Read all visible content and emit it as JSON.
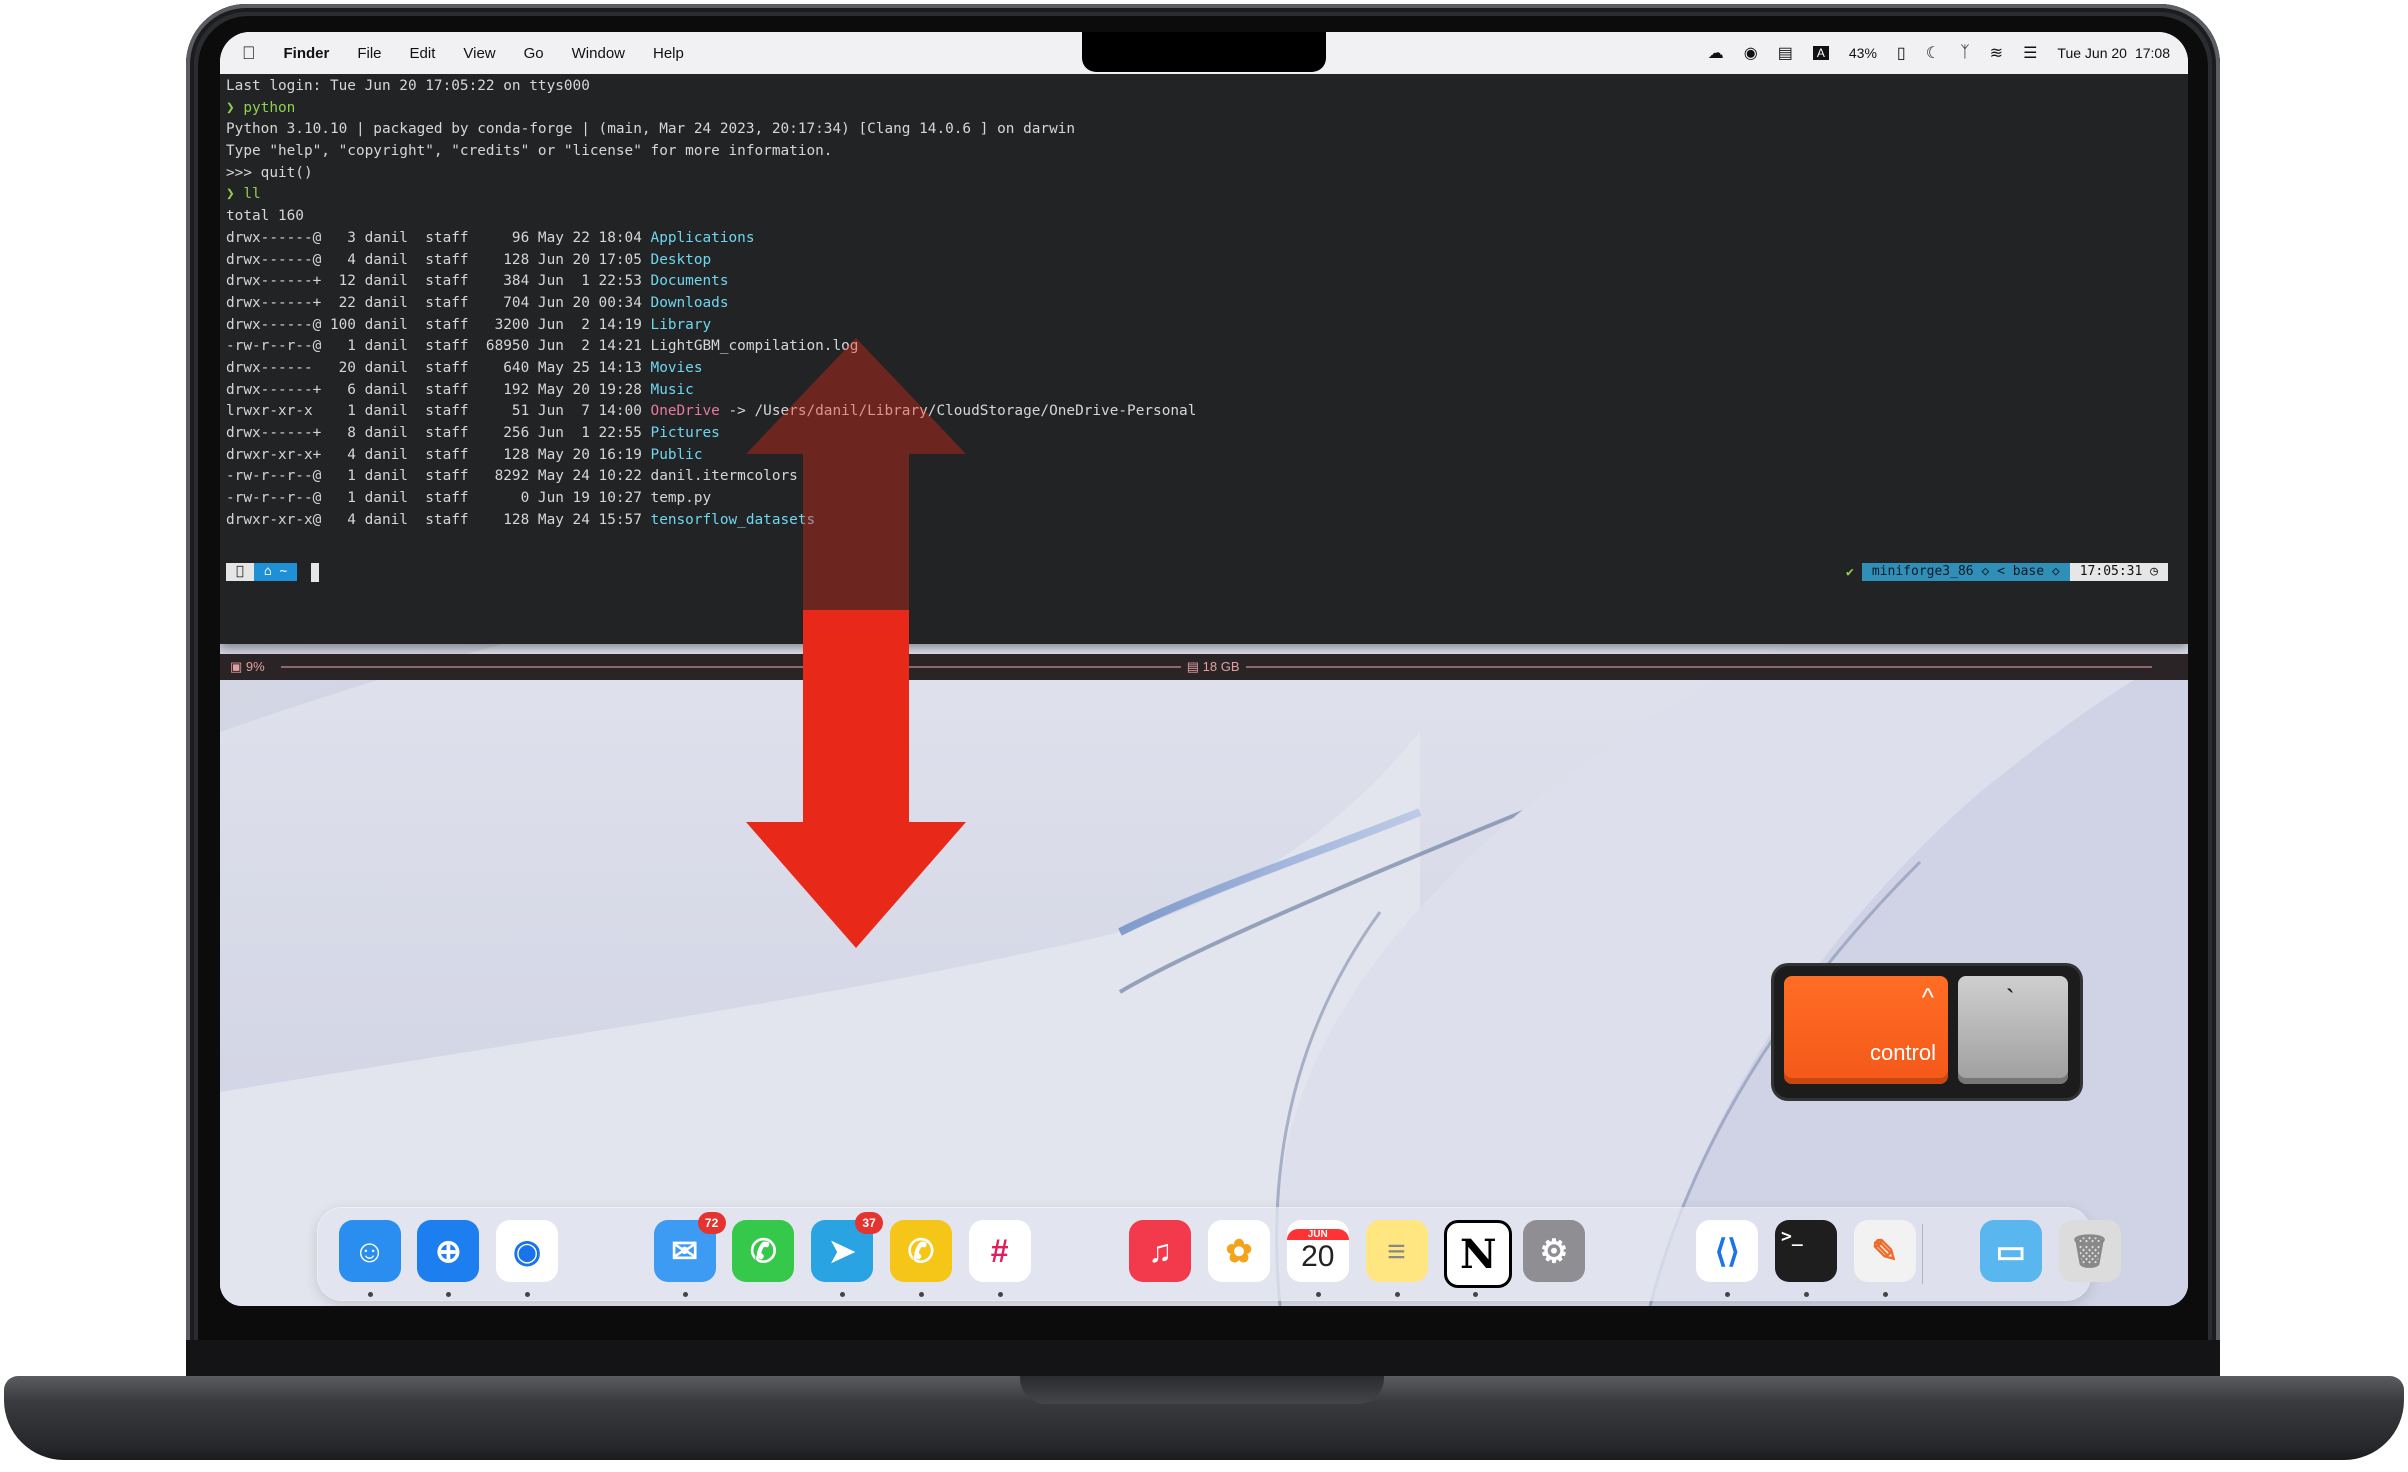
{
  "menubar": {
    "apple_icon": "apple-icon",
    "app_name": "Finder",
    "items": [
      "File",
      "Edit",
      "View",
      "Go",
      "Window",
      "Help"
    ],
    "battery": "43%",
    "date": "Tue Jun 20",
    "time": "17:08",
    "icons": [
      "cloud-icon",
      "onepassword-icon",
      "chat-icon",
      "keyboard-input-icon",
      "battery-icon",
      "moon-icon",
      "bluetooth-icon",
      "wifi-icon",
      "control-center-icon"
    ]
  },
  "terminal": {
    "lines": [
      {
        "text": "Last login: Tue Jun 20 17:05:22 on ttys000"
      },
      {
        "prompt": "❯",
        "text": " python"
      },
      {
        "text": "Python 3.10.10 | packaged by conda-forge | (main, Mar 24 2023, 20:17:34) [Clang 14.0.6 ] on darwin"
      },
      {
        "text": "Type \"help\", \"copyright\", \"credits\" or \"license\" for more information."
      },
      {
        "text": ">>> quit()"
      },
      {
        "prompt": "❯",
        "text": " ll"
      },
      {
        "text": "total 160"
      }
    ],
    "listing": [
      {
        "meta": "drwx------@   3 danil  staff     96 May 22 18:04 ",
        "name": "Applications",
        "color": "cyan"
      },
      {
        "meta": "drwx------@   4 danil  staff    128 Jun 20 17:05 ",
        "name": "Desktop",
        "color": "cyan"
      },
      {
        "meta": "drwx------+  12 danil  staff    384 Jun  1 22:53 ",
        "name": "Documents",
        "color": "cyan"
      },
      {
        "meta": "drwx------+  22 danil  staff    704 Jun 20 00:34 ",
        "name": "Downloads",
        "color": "cyan"
      },
      {
        "meta": "drwx------@ 100 danil  staff   3200 Jun  2 14:19 ",
        "name": "Library",
        "color": "cyan"
      },
      {
        "meta": "-rw-r--r--@   1 danil  staff  68950 Jun  2 14:21 ",
        "name": "LightGBM_compilation.log",
        "color": "plain"
      },
      {
        "meta": "drwx------   20 danil  staff    640 May 25 14:13 ",
        "name": "Movies",
        "color": "cyan"
      },
      {
        "meta": "drwx------+   6 danil  staff    192 May 20 19:28 ",
        "name": "Music",
        "color": "cyan"
      },
      {
        "meta": "lrwxr-xr-x    1 danil  staff     51 Jun  7 14:00 ",
        "name": "OneDrive",
        "color": "pink",
        "link": " -> /Users/danil/Library/CloudStorage/OneDrive-Personal"
      },
      {
        "meta": "drwx------+   8 danil  staff    256 Jun  1 22:55 ",
        "name": "Pictures",
        "color": "cyan"
      },
      {
        "meta": "drwxr-xr-x+   4 danil  staff    128 May 20 16:19 ",
        "name": "Public",
        "color": "cyan"
      },
      {
        "meta": "-rw-r--r--@   1 danil  staff   8292 May 24 10:22 ",
        "name": "danil.itermcolors",
        "color": "plain"
      },
      {
        "meta": "-rw-r--r--@   1 danil  staff      0 Jun 19 10:27 ",
        "name": "temp.py",
        "color": "plain"
      },
      {
        "meta": "drwxr-xr-x@   4 danil  staff    128 May 24 15:57 ",
        "name": "tensorflow_datasets",
        "color": "cyan"
      }
    ],
    "prompt_left": {
      "home": "~"
    },
    "prompt_right": {
      "check": "✔",
      "env1": "miniforge3_86",
      "env2": "base",
      "time": "17:05:31"
    },
    "status": {
      "cpu": "9%",
      "disk": "18 GB"
    }
  },
  "keys": {
    "control_symbol": "^",
    "control_label": "control",
    "tick_label": "`"
  },
  "dock": {
    "apps": [
      {
        "name": "Finder",
        "icon": "finder-icon",
        "color": "#2a8ef0"
      },
      {
        "name": "Safari",
        "icon": "safari-icon",
        "color": "#1d7ef0"
      },
      {
        "name": "Chrome",
        "icon": "chrome-icon",
        "color": "#ffffff"
      },
      {
        "name": "Mail",
        "icon": "mail-icon",
        "color": "#3d9bf3",
        "badge": "72"
      },
      {
        "name": "Messages",
        "icon": "messages-icon",
        "color": "#36c84a"
      },
      {
        "name": "Telegram",
        "icon": "telegram-icon",
        "color": "#2aa3e3",
        "badge": "37"
      },
      {
        "name": "WhatsApp",
        "icon": "whatsapp-icon",
        "color": "#f5c518"
      },
      {
        "name": "Slack",
        "icon": "slack-icon",
        "color": "#ffffff"
      },
      {
        "name": "Music",
        "icon": "music-icon",
        "color": "#f3394c"
      },
      {
        "name": "Photos",
        "icon": "photos-icon",
        "color": "#ffffff"
      },
      {
        "name": "Calendar",
        "icon": "calendar-icon",
        "color": "#ffffff",
        "month": "JUN",
        "day": "20"
      },
      {
        "name": "Notes",
        "icon": "notes-icon",
        "color": "#ffe680"
      },
      {
        "name": "Notion",
        "icon": "notion-icon",
        "color": "#ffffff",
        "letter": "N"
      },
      {
        "name": "System Settings",
        "icon": "settings-icon",
        "color": "#8e8e93"
      },
      {
        "name": "VS Code",
        "icon": "vscode-icon",
        "color": "#ffffff"
      },
      {
        "name": "Terminal",
        "icon": "terminal-icon",
        "color": "#1e1e1e",
        "glyph": ">_"
      },
      {
        "name": "Pixelmator",
        "icon": "pixelmator-icon",
        "color": "#f2f2f2"
      },
      {
        "name": "Downloads",
        "icon": "folder-icon",
        "color": "#5ab6ef"
      },
      {
        "name": "Trash",
        "icon": "trash-icon",
        "color": "#dcdcdc"
      }
    ]
  },
  "colors": {
    "accent_arrow": "#e8291a",
    "control_key": "#f4581a"
  }
}
